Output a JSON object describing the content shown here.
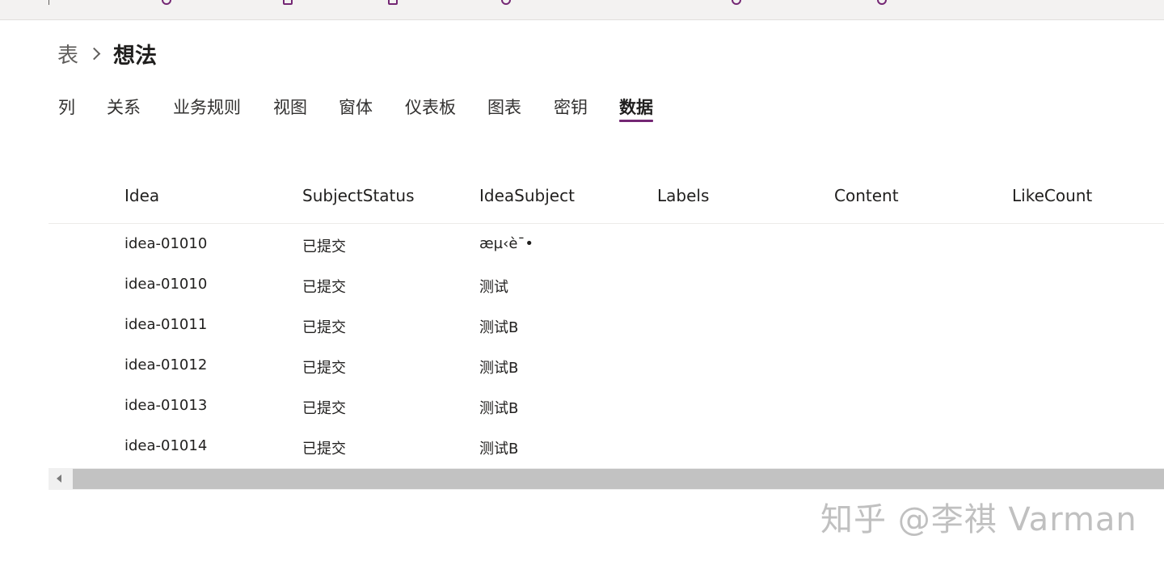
{
  "topbar": {
    "items": [
      "",
      "",
      "",
      "",
      "",
      "",
      "",
      ""
    ]
  },
  "breadcrumb": {
    "root": "表",
    "current": "想法"
  },
  "tabs": [
    {
      "label": "列"
    },
    {
      "label": "关系"
    },
    {
      "label": "业务规则"
    },
    {
      "label": "视图"
    },
    {
      "label": "窗体"
    },
    {
      "label": "仪表板"
    },
    {
      "label": "图表"
    },
    {
      "label": "密钥"
    },
    {
      "label": "数据",
      "active": true
    }
  ],
  "grid": {
    "columns": [
      "Idea",
      "SubjectStatus",
      "IdeaSubject",
      "Labels",
      "Content",
      "LikeCount"
    ],
    "rows": [
      [
        "idea-01010",
        "已提交",
        "æµ‹è¯•",
        "",
        "",
        ""
      ],
      [
        "idea-01010",
        "已提交",
        "测试",
        "",
        "",
        ""
      ],
      [
        "idea-01011",
        "已提交",
        "测试B",
        "",
        "",
        ""
      ],
      [
        "idea-01012",
        "已提交",
        "测试B",
        "",
        "",
        ""
      ],
      [
        "idea-01013",
        "已提交",
        "测试B",
        "",
        "",
        ""
      ],
      [
        "idea-01014",
        "已提交",
        "测试B",
        "",
        "",
        ""
      ]
    ]
  },
  "watermark": "知乎 @李祺 Varman",
  "colors": {
    "accent": "#742774",
    "scroll_thumb": "#c2c2c2"
  }
}
